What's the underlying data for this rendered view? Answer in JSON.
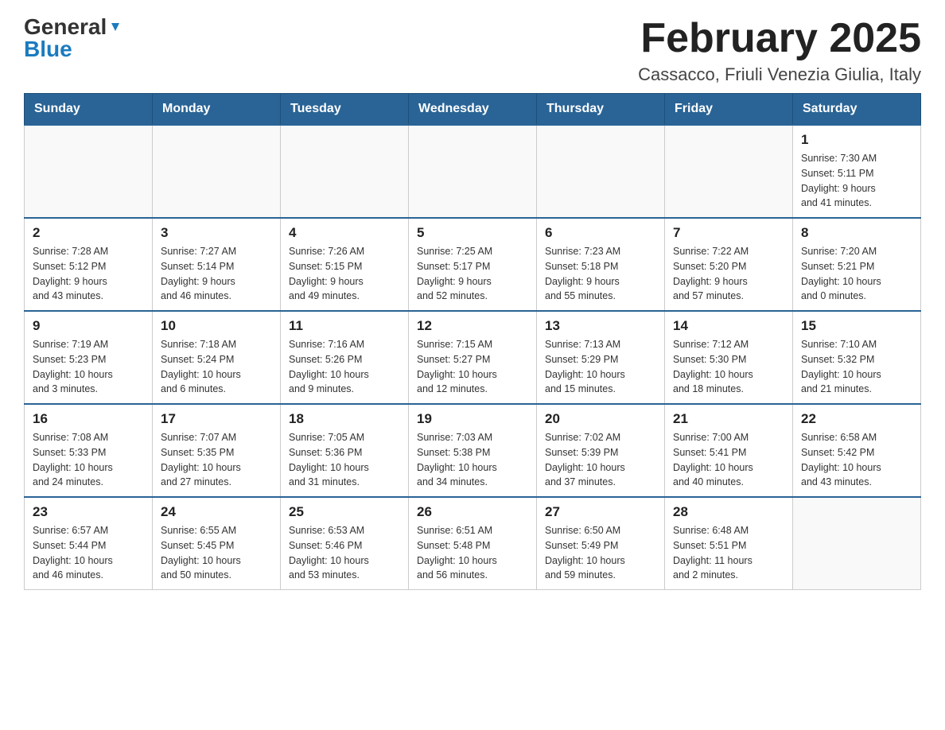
{
  "header": {
    "logo": {
      "general": "General",
      "blue": "Blue"
    },
    "title": "February 2025",
    "location": "Cassacco, Friuli Venezia Giulia, Italy"
  },
  "weekdays": [
    "Sunday",
    "Monday",
    "Tuesday",
    "Wednesday",
    "Thursday",
    "Friday",
    "Saturday"
  ],
  "weeks": [
    [
      {
        "day": "",
        "info": ""
      },
      {
        "day": "",
        "info": ""
      },
      {
        "day": "",
        "info": ""
      },
      {
        "day": "",
        "info": ""
      },
      {
        "day": "",
        "info": ""
      },
      {
        "day": "",
        "info": ""
      },
      {
        "day": "1",
        "info": "Sunrise: 7:30 AM\nSunset: 5:11 PM\nDaylight: 9 hours\nand 41 minutes."
      }
    ],
    [
      {
        "day": "2",
        "info": "Sunrise: 7:28 AM\nSunset: 5:12 PM\nDaylight: 9 hours\nand 43 minutes."
      },
      {
        "day": "3",
        "info": "Sunrise: 7:27 AM\nSunset: 5:14 PM\nDaylight: 9 hours\nand 46 minutes."
      },
      {
        "day": "4",
        "info": "Sunrise: 7:26 AM\nSunset: 5:15 PM\nDaylight: 9 hours\nand 49 minutes."
      },
      {
        "day": "5",
        "info": "Sunrise: 7:25 AM\nSunset: 5:17 PM\nDaylight: 9 hours\nand 52 minutes."
      },
      {
        "day": "6",
        "info": "Sunrise: 7:23 AM\nSunset: 5:18 PM\nDaylight: 9 hours\nand 55 minutes."
      },
      {
        "day": "7",
        "info": "Sunrise: 7:22 AM\nSunset: 5:20 PM\nDaylight: 9 hours\nand 57 minutes."
      },
      {
        "day": "8",
        "info": "Sunrise: 7:20 AM\nSunset: 5:21 PM\nDaylight: 10 hours\nand 0 minutes."
      }
    ],
    [
      {
        "day": "9",
        "info": "Sunrise: 7:19 AM\nSunset: 5:23 PM\nDaylight: 10 hours\nand 3 minutes."
      },
      {
        "day": "10",
        "info": "Sunrise: 7:18 AM\nSunset: 5:24 PM\nDaylight: 10 hours\nand 6 minutes."
      },
      {
        "day": "11",
        "info": "Sunrise: 7:16 AM\nSunset: 5:26 PM\nDaylight: 10 hours\nand 9 minutes."
      },
      {
        "day": "12",
        "info": "Sunrise: 7:15 AM\nSunset: 5:27 PM\nDaylight: 10 hours\nand 12 minutes."
      },
      {
        "day": "13",
        "info": "Sunrise: 7:13 AM\nSunset: 5:29 PM\nDaylight: 10 hours\nand 15 minutes."
      },
      {
        "day": "14",
        "info": "Sunrise: 7:12 AM\nSunset: 5:30 PM\nDaylight: 10 hours\nand 18 minutes."
      },
      {
        "day": "15",
        "info": "Sunrise: 7:10 AM\nSunset: 5:32 PM\nDaylight: 10 hours\nand 21 minutes."
      }
    ],
    [
      {
        "day": "16",
        "info": "Sunrise: 7:08 AM\nSunset: 5:33 PM\nDaylight: 10 hours\nand 24 minutes."
      },
      {
        "day": "17",
        "info": "Sunrise: 7:07 AM\nSunset: 5:35 PM\nDaylight: 10 hours\nand 27 minutes."
      },
      {
        "day": "18",
        "info": "Sunrise: 7:05 AM\nSunset: 5:36 PM\nDaylight: 10 hours\nand 31 minutes."
      },
      {
        "day": "19",
        "info": "Sunrise: 7:03 AM\nSunset: 5:38 PM\nDaylight: 10 hours\nand 34 minutes."
      },
      {
        "day": "20",
        "info": "Sunrise: 7:02 AM\nSunset: 5:39 PM\nDaylight: 10 hours\nand 37 minutes."
      },
      {
        "day": "21",
        "info": "Sunrise: 7:00 AM\nSunset: 5:41 PM\nDaylight: 10 hours\nand 40 minutes."
      },
      {
        "day": "22",
        "info": "Sunrise: 6:58 AM\nSunset: 5:42 PM\nDaylight: 10 hours\nand 43 minutes."
      }
    ],
    [
      {
        "day": "23",
        "info": "Sunrise: 6:57 AM\nSunset: 5:44 PM\nDaylight: 10 hours\nand 46 minutes."
      },
      {
        "day": "24",
        "info": "Sunrise: 6:55 AM\nSunset: 5:45 PM\nDaylight: 10 hours\nand 50 minutes."
      },
      {
        "day": "25",
        "info": "Sunrise: 6:53 AM\nSunset: 5:46 PM\nDaylight: 10 hours\nand 53 minutes."
      },
      {
        "day": "26",
        "info": "Sunrise: 6:51 AM\nSunset: 5:48 PM\nDaylight: 10 hours\nand 56 minutes."
      },
      {
        "day": "27",
        "info": "Sunrise: 6:50 AM\nSunset: 5:49 PM\nDaylight: 10 hours\nand 59 minutes."
      },
      {
        "day": "28",
        "info": "Sunrise: 6:48 AM\nSunset: 5:51 PM\nDaylight: 11 hours\nand 2 minutes."
      },
      {
        "day": "",
        "info": ""
      }
    ]
  ]
}
